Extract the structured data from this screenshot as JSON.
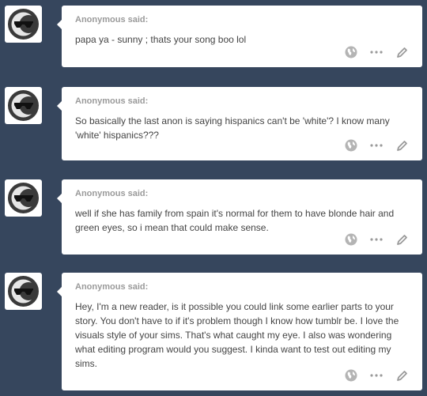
{
  "posts": [
    {
      "asker": "Anonymous said:",
      "question": "papa ya - sunny ; thats your song boo lol"
    },
    {
      "asker": "Anonymous said:",
      "question": "So basically the last anon is saying hispanics can't be 'white'? I know many 'white' hispanics???"
    },
    {
      "asker": "Anonymous said:",
      "question": "well if she has family from spain it's normal for them to have blonde hair and green eyes, so i mean that could make sense."
    },
    {
      "asker": "Anonymous said:",
      "question": "Hey, I'm a new reader, is it possible you could link some earlier parts to your story. You don't have to if it's problem though I know how tumblr be. I love the visuals style of your sims. That's what caught my eye. I also was wondering what editing program would you suggest. I kinda want to test out editing my sims."
    }
  ],
  "icons": {
    "avatar": "anonymous-sunglasses-avatar-icon",
    "share": "globe-icon",
    "more": "ellipsis-icon",
    "answer": "pencil-icon"
  },
  "colors": {
    "background": "#36465d",
    "card": "#ffffff",
    "asker_text": "#9a9a9a",
    "body_text": "#444444",
    "icon_gray": "#b4b4b4"
  }
}
